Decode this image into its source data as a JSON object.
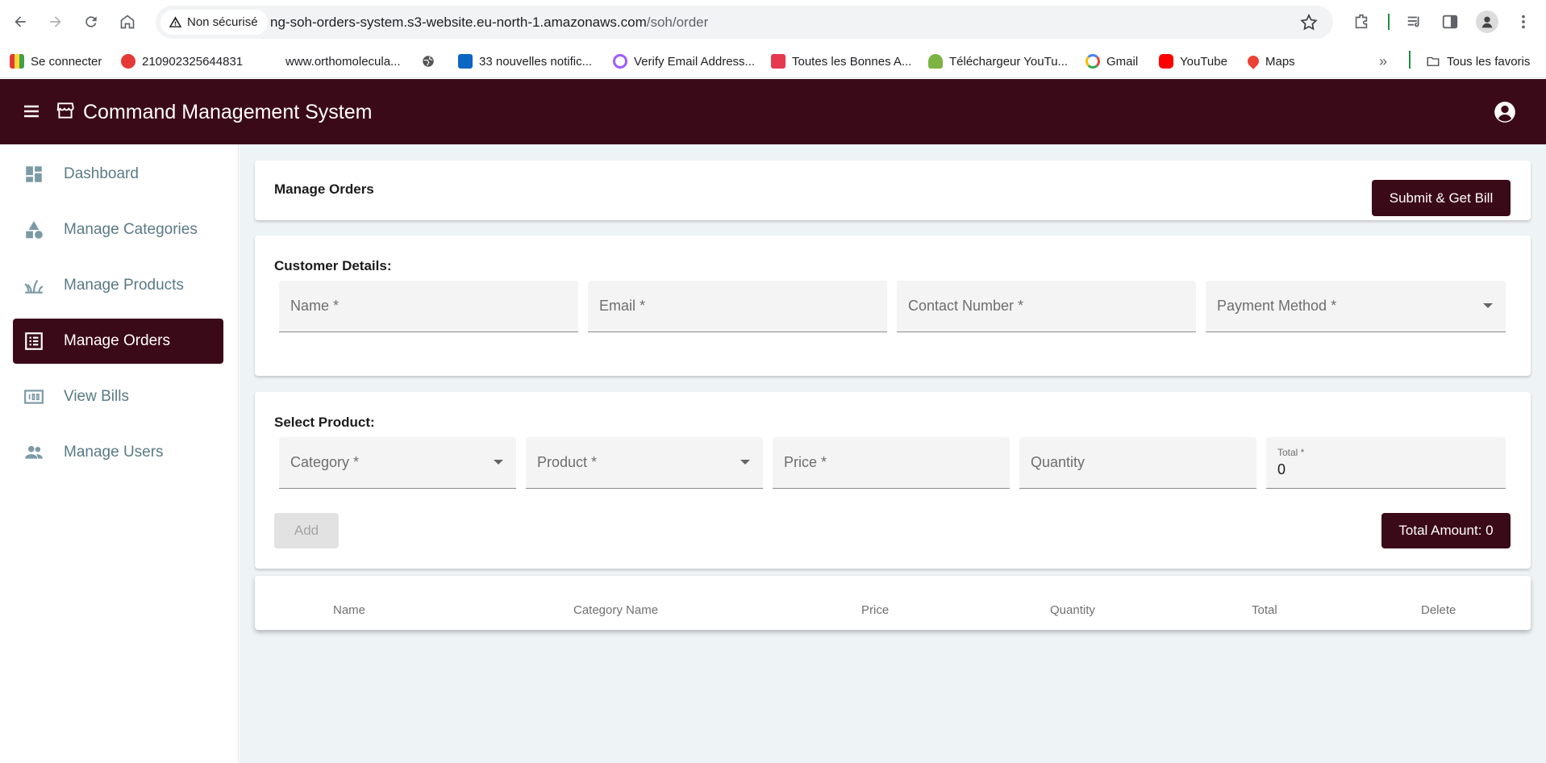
{
  "browser": {
    "security_label": "Non sécurisé",
    "url_host": "ng-soh-orders-system.s3-website.eu-north-1.amazonaws.com",
    "url_path": "/soh/order",
    "bookmarks": [
      {
        "label": "Se connecter",
        "icon": "bookmark-favicon-icon"
      },
      {
        "label": "210902325644831",
        "icon": "huawei-icon"
      },
      {
        "label": "www.orthomolecula...",
        "icon": "globe-icon"
      },
      {
        "label": "",
        "icon": "globe-icon"
      },
      {
        "label": "33 nouvelles notific...",
        "icon": "linkedin-icon"
      },
      {
        "label": "Verify Email Address...",
        "icon": "verify-icon"
      },
      {
        "label": "Toutes les Bonnes A...",
        "icon": "shop-icon"
      },
      {
        "label": "Téléchargeur YouTu...",
        "icon": "download-icon"
      },
      {
        "label": "Gmail",
        "icon": "google-icon"
      },
      {
        "label": "YouTube",
        "icon": "youtube-icon"
      },
      {
        "label": "Maps",
        "icon": "maps-icon"
      }
    ],
    "all_bookmarks_label": "Tous les favoris"
  },
  "app": {
    "title": "Command Management System"
  },
  "sidebar": {
    "items": [
      {
        "label": "Dashboard",
        "icon": "dashboard-icon",
        "active": false
      },
      {
        "label": "Manage Categories",
        "icon": "category-icon",
        "active": false
      },
      {
        "label": "Manage Products",
        "icon": "product-icon",
        "active": false
      },
      {
        "label": "Manage Orders",
        "icon": "list-icon",
        "active": true
      },
      {
        "label": "View Bills",
        "icon": "bill-icon",
        "active": false
      },
      {
        "label": "Manage Users",
        "icon": "users-icon",
        "active": false
      }
    ]
  },
  "orders": {
    "heading": "Manage Orders",
    "submit_label": "Submit & Get Bill",
    "customer": {
      "title": "Customer Details:",
      "name_placeholder": "Name *",
      "email_placeholder": "Email *",
      "contact_placeholder": "Contact Number *",
      "payment_placeholder": "Payment Method *"
    },
    "product": {
      "title": "Select Product:",
      "category_placeholder": "Category *",
      "product_placeholder": "Product *",
      "price_placeholder": "Price *",
      "quantity_placeholder": "Quantity",
      "total_label": "Total *",
      "total_value": "0",
      "add_label": "Add",
      "total_amount_label": "Total Amount: 0"
    },
    "table": {
      "columns": [
        "Name",
        "Category Name",
        "Price",
        "Quantity",
        "Total",
        "Delete"
      ]
    }
  },
  "colors": {
    "brand": "#3b0a18",
    "sidebar_text": "#5a7a86",
    "background": "#eef3f6"
  }
}
